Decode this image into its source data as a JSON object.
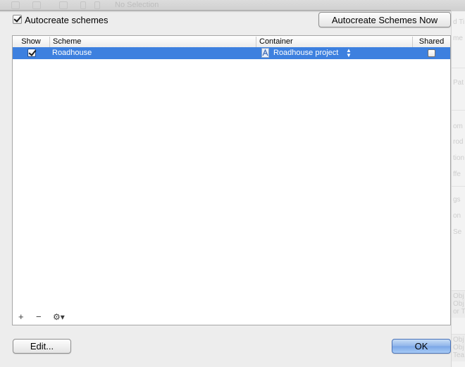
{
  "background": {
    "toolbar_title": "No Selection",
    "side_fragments": [
      "d Ti",
      "me",
      "Pat",
      "om",
      "rod",
      "tion",
      "ffe",
      "gs",
      "on",
      "Se",
      "Obj",
      "Obj",
      "or Ti",
      "Obj",
      "Obj",
      "Tea"
    ]
  },
  "autocreate": {
    "label": "Autocreate schemes",
    "checked": true,
    "button_label": "Autocreate Schemes Now"
  },
  "table": {
    "headers": {
      "show": "Show",
      "scheme": "Scheme",
      "container": "Container",
      "shared": "Shared"
    },
    "rows": [
      {
        "show": true,
        "scheme": "Roadhouse",
        "container": "Roadhouse project",
        "shared": false,
        "selected": true
      }
    ],
    "tools": {
      "add": "+",
      "remove": "−",
      "gear": "⚙▾"
    }
  },
  "buttons": {
    "edit": "Edit...",
    "ok": "OK"
  },
  "colors": {
    "selection": "#3d80df",
    "default_button": "#8fb5ea"
  }
}
